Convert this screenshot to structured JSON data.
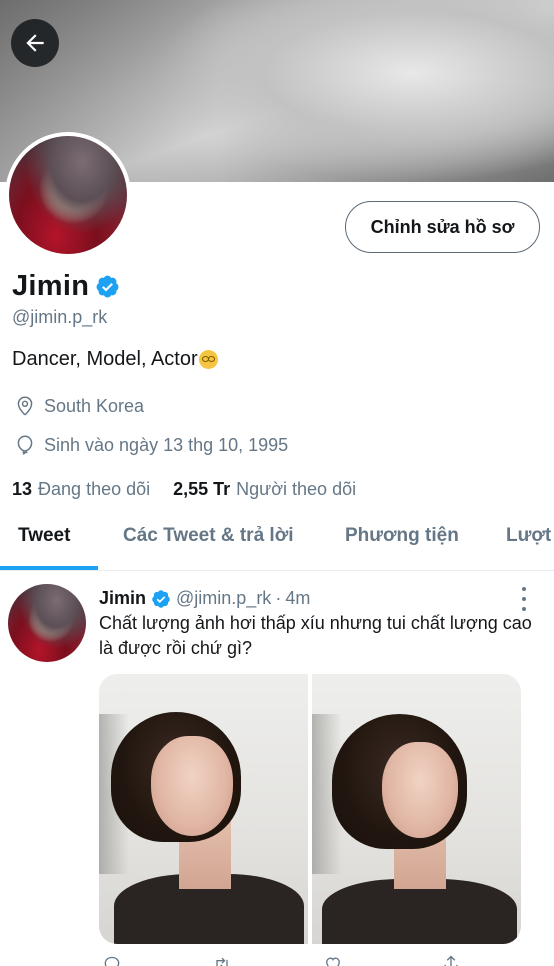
{
  "profile": {
    "display_name": "Jimin",
    "handle": "@jimin.p_rk",
    "bio": "Dancer, Model, Actor",
    "location": "South Korea",
    "birthday": "Sinh vào ngày 13 thg 10, 1995",
    "following_count": "13",
    "following_label": "Đang theo dõi",
    "followers_count": "2,55 Tr",
    "followers_label": "Người theo dõi",
    "edit_button": "Chỉnh sửa hồ sơ"
  },
  "icons": {
    "back": "arrow-left-icon",
    "verified": "verified-badge-icon",
    "location": "location-pin-icon",
    "birthday": "balloon-icon",
    "more": "more-vertical-icon",
    "reply": "reply-icon",
    "retweet": "retweet-icon",
    "like": "heart-icon",
    "share": "share-icon"
  },
  "tabs": [
    {
      "label": "Tweet",
      "active": true
    },
    {
      "label": "Các Tweet & trả lời",
      "active": false
    },
    {
      "label": "Phương tiện",
      "active": false
    },
    {
      "label": "Lượt thích",
      "active": false
    }
  ],
  "tweet": {
    "name": "Jimin",
    "handle": "@jimin.p_rk",
    "separator": "·",
    "time": "4m",
    "text": "Chất lượng ảnh hơi thấp xíu nhưng tui chất lượng cao là được rồi chứ gì?",
    "media_count": 2
  },
  "colors": {
    "accent": "#1da1f2",
    "text_primary": "#14171a",
    "text_secondary": "#657786",
    "border": "#e6ecf0"
  }
}
